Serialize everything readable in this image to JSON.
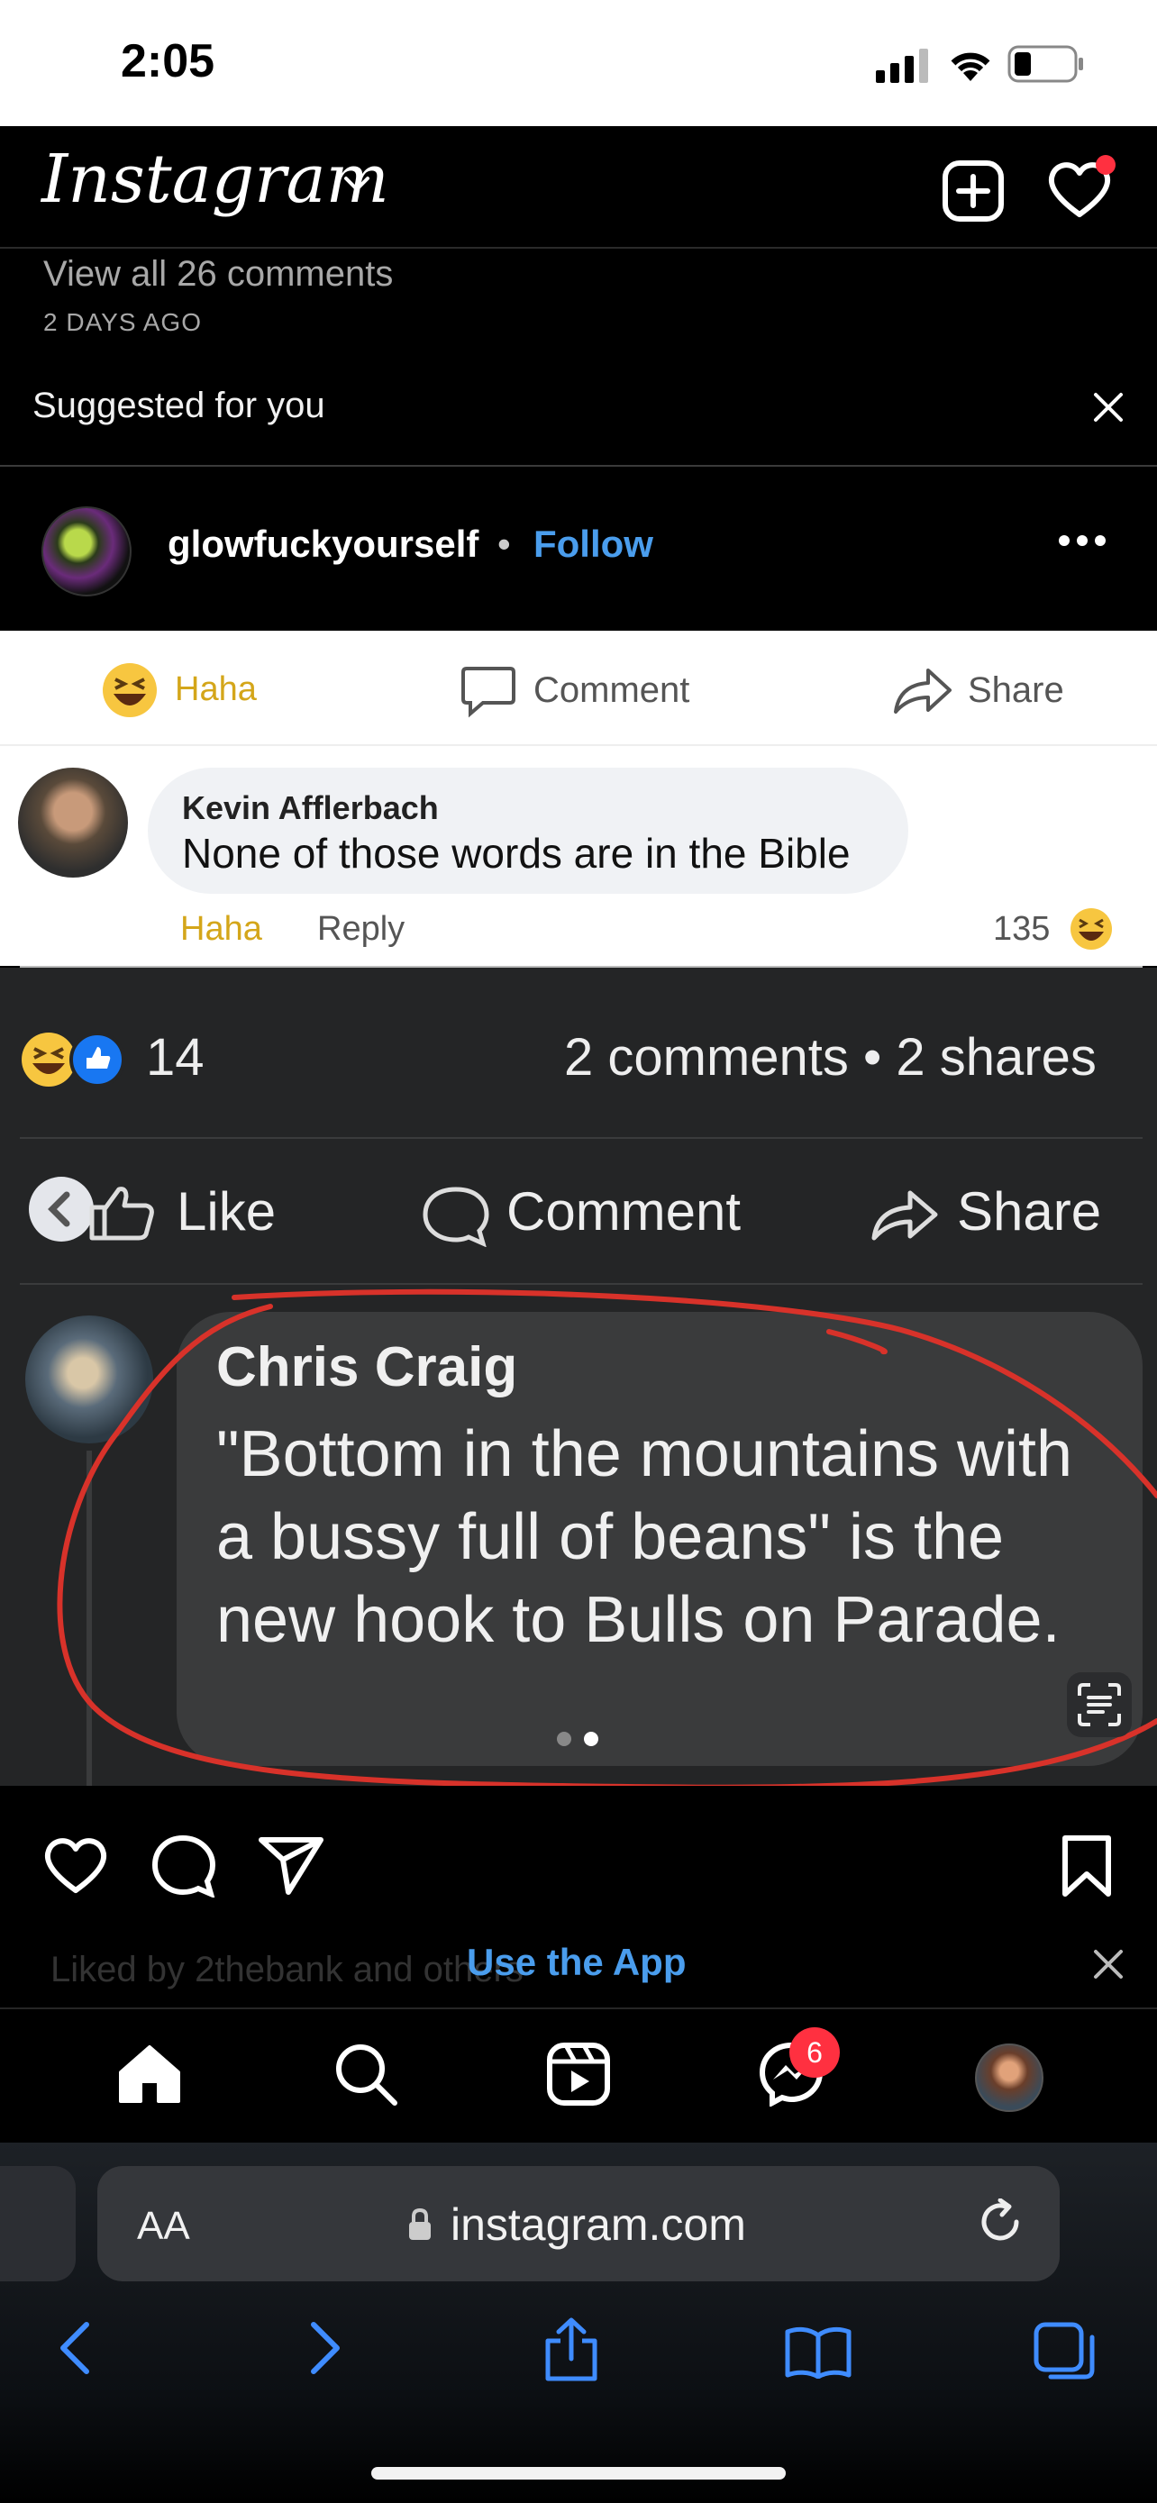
{
  "status_bar": {
    "time": "2:05"
  },
  "header": {
    "app_name": "Instagram"
  },
  "post_meta": {
    "view_comments": "View all 26 comments",
    "time_ago": "2 DAYS AGO"
  },
  "suggested": {
    "label": "Suggested for you"
  },
  "post": {
    "username": "glowfuckyourself",
    "separator": "•",
    "follow_label": "Follow"
  },
  "embedded_light": {
    "actions": {
      "haha": "Haha",
      "comment": "Comment",
      "share": "Share"
    },
    "comment": {
      "name": "Kevin Afflerbach",
      "text": "None of those words are in the Bible",
      "haha": "Haha",
      "reply": "Reply",
      "reaction_count": "135"
    }
  },
  "embedded_dark": {
    "reaction_count": "14",
    "comments_shares": "2 comments • 2 shares",
    "actions": {
      "like": "Like",
      "comment": "Comment",
      "share": "Share"
    },
    "comment": {
      "name": "Chris Craig",
      "text": "\"Bottom in the mountains with a bussy full of beans\" is the new hook to Bulls on Parade."
    },
    "carousel": {
      "total": 2,
      "active": 2
    }
  },
  "banner": {
    "liked_by": "Liked by 2thebank and others",
    "use_app": "Use the App"
  },
  "bottom_nav": {
    "items": [
      "home-icon",
      "search-icon",
      "reels-icon",
      "messenger-icon",
      "profile-avatar"
    ],
    "messenger_badge": "6"
  },
  "safari": {
    "aa_label": "AA",
    "url": "instagram.com"
  },
  "colors": {
    "link_blue": "#4a9ded",
    "notification_red": "#ff3040",
    "annotation_red": "#d8322a",
    "haha_yellow": "#d4a61a"
  }
}
